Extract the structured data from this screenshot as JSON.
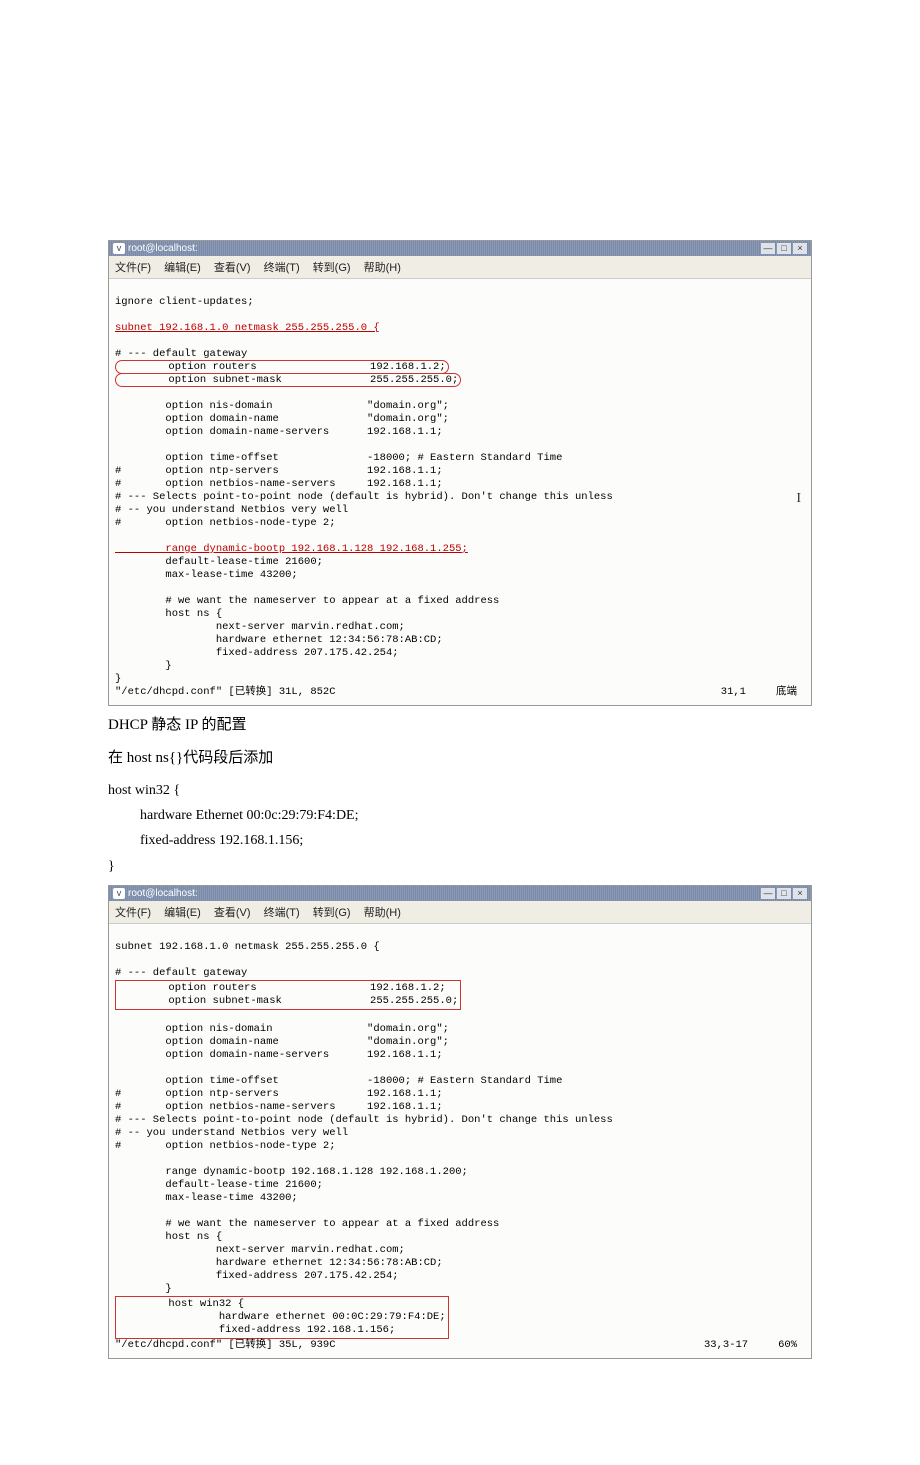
{
  "window1": {
    "title": "root@localhost:",
    "menu": {
      "file": "文件(F)",
      "edit": "编辑(E)",
      "view": "查看(V)",
      "term": "终端(T)",
      "goto": "转到(G)",
      "help": "帮助(H)"
    },
    "line1": "ignore client-updates;",
    "line2": "subnet 192.168.1.0 netmask 255.255.255.0 {",
    "gw_comment": "# --- default gateway",
    "routers": "        option routers                  192.168.1.2;",
    "subnetmask": "        option subnet-mask              255.255.255.0;",
    "nisdomain": "        option nis-domain               \"domain.org\";",
    "domname": "        option domain-name              \"domain.org\";",
    "dns": "        option domain-name-servers      192.168.1.1;",
    "timeoff": "        option time-offset              -18000; # Eastern Standard Time",
    "ntp": "#       option ntp-servers              192.168.1.1;",
    "netbios": "#       option netbios-name-servers     192.168.1.1;",
    "sel1": "# --- Selects point-to-point node (default is hybrid). Don't change this unless",
    "sel2": "# -- you understand Netbios very well",
    "nodetype": "#       option netbios-node-type 2;",
    "range": "        range dynamic-bootp 192.168.1.128 192.168.1.255;",
    "deflease": "        default-lease-time 21600;",
    "maxlease": "        max-lease-time 43200;",
    "wantns": "        # we want the nameserver to appear at a fixed address",
    "hostns": "        host ns {",
    "nextsrv": "                next-server marvin.redhat.com;",
    "hw": "                hardware ethernet 12:34:56:78:AB:CD;",
    "fixed": "                fixed-address 207.175.42.254;",
    "closebr": "        }",
    "closebr2": "}",
    "status_l": "\"/etc/dhcpd.conf\" [已转换] 31L, 852C",
    "status_pos": "31,1",
    "status_r": "底端"
  },
  "prose": {
    "h1": "DHCP 静态 IP 的配置",
    "p1": "在 host ns{}代码段后添加",
    "hostwin": "host win32 {",
    "hw": "hardware Ethernet 00:0c:29:79:F4:DE;",
    "fixed": "fixed-address 192.168.1.156;",
    "close": "}"
  },
  "window2": {
    "title": "root@localhost:",
    "menu": {
      "file": "文件(F)",
      "edit": "编辑(E)",
      "view": "查看(V)",
      "term": "终端(T)",
      "goto": "转到(G)",
      "help": "帮助(H)"
    },
    "line2": "subnet 192.168.1.0 netmask 255.255.255.0 {",
    "gw_comment": "# --- default gateway",
    "routers": "        option routers                  192.168.1.2;",
    "subnetmask": "        option subnet-mask              255.255.255.0;",
    "nisdomain": "        option nis-domain               \"domain.org\";",
    "domname": "        option domain-name              \"domain.org\";",
    "dns": "        option domain-name-servers      192.168.1.1;",
    "timeoff": "        option time-offset              -18000; # Eastern Standard Time",
    "ntp": "#       option ntp-servers              192.168.1.1;",
    "netbios": "#       option netbios-name-servers     192.168.1.1;",
    "sel1": "# --- Selects point-to-point node (default is hybrid). Don't change this unless",
    "sel2": "# -- you understand Netbios very well",
    "nodetype": "#       option netbios-node-type 2;",
    "range": "        range dynamic-bootp 192.168.1.128 192.168.1.200;",
    "deflease": "        default-lease-time 21600;",
    "maxlease": "        max-lease-time 43200;",
    "wantns": "        # we want the nameserver to appear at a fixed address",
    "hostns": "        host ns {",
    "nextsrv": "                next-server marvin.redhat.com;",
    "hw": "                hardware ethernet 12:34:56:78:AB:CD;",
    "fixed": "                fixed-address 207.175.42.254;",
    "closebr": "        }",
    "hostwin": "        host win32 {",
    "whw": "                hardware ethernet 00:0C:29:79:F4:DE;",
    "wfix": "                fixed-address 192.168.1.156;",
    "status_l": "\"/etc/dhcpd.conf\" [已转换] 35L, 939C",
    "status_pos": "33,3-17",
    "status_r": "60%"
  }
}
